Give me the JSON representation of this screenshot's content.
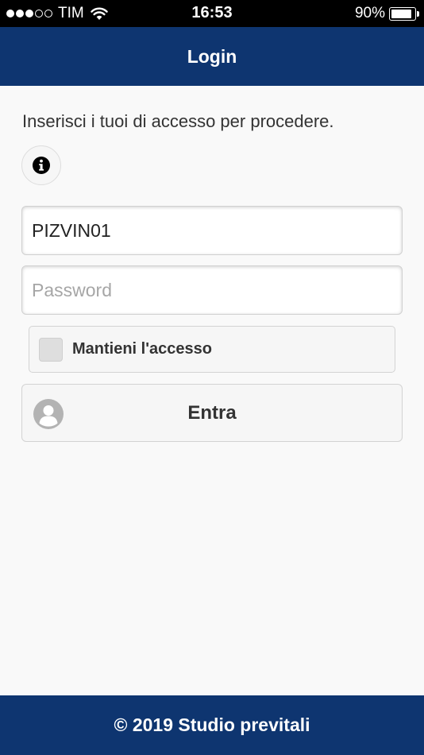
{
  "status_bar": {
    "signal_dots": [
      "full",
      "full",
      "full",
      "empty",
      "empty"
    ],
    "carrier": "TIM",
    "wifi_icon": "wifi-icon",
    "time": "16:53",
    "battery_percent": "90%",
    "battery_level": 0.9
  },
  "header": {
    "title": "Login"
  },
  "form": {
    "instruction": "Inserisci i tuoi di accesso per procedere.",
    "info_icon": "info-icon",
    "username": {
      "value": "PIZVIN01",
      "placeholder": ""
    },
    "password": {
      "value": "",
      "placeholder": "Password"
    },
    "remember": {
      "label": "Mantieni l'accesso",
      "checked": false
    },
    "submit": {
      "label": "Entra",
      "icon": "user-icon"
    }
  },
  "footer": {
    "text": "© 2019 Studio previtali"
  },
  "colors": {
    "brand": "#0e3570",
    "background": "#f9f9f9",
    "status_bar": "#000000"
  }
}
